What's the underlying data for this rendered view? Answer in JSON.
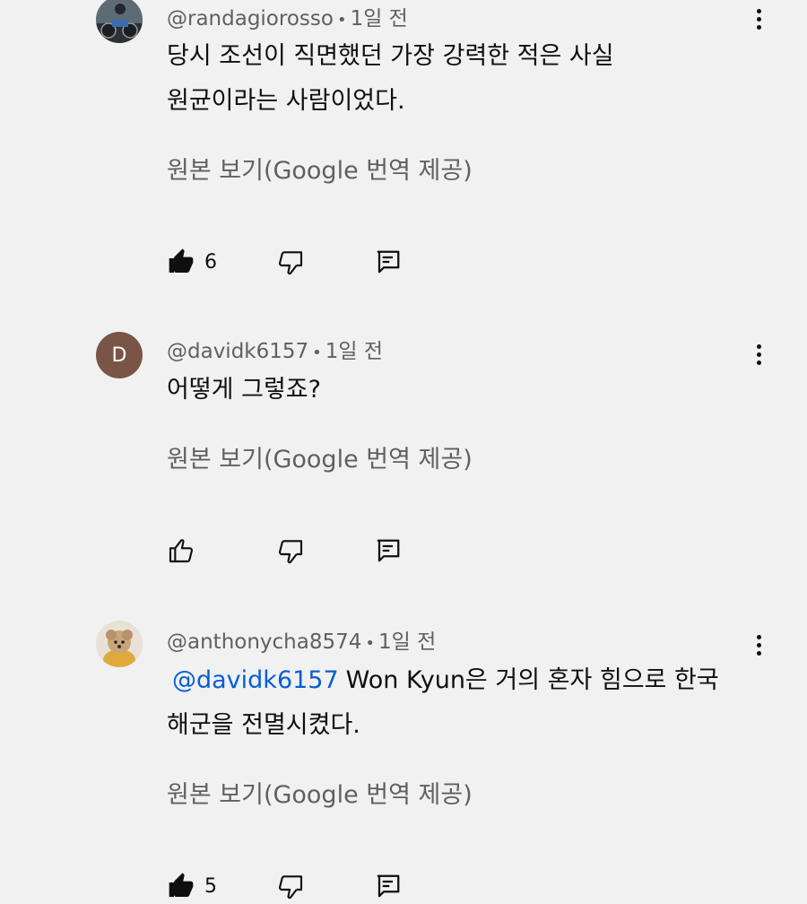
{
  "comments": [
    {
      "handle": "@randagiorosso",
      "time": "1일 전",
      "lines": [
        "당시 조선이 직면했던 가장 강력한 적은 사실",
        "원균이라는 사람이었다."
      ],
      "translate": "원본 보기(Google 번역 제공)",
      "likes": "6",
      "liked": true
    },
    {
      "handle": "@davidk6157",
      "avatar_letter": "D",
      "time": "1일 전",
      "lines": [
        "어떻게 그렇죠?"
      ],
      "translate": "원본 보기(Google 번역 제공)",
      "likes": "",
      "liked": false
    },
    {
      "handle": "@anthonycha8574",
      "time": "1일 전",
      "mention": "@davidk6157",
      "lines": [
        "Won Kyun은 거의 혼자 힘으로 한국",
        "해군을 전멸시켰다."
      ],
      "translate": "원본 보기(Google 번역 제공)",
      "likes": "5",
      "liked": true
    }
  ],
  "separator": "•",
  "colors": {
    "mention": "#065fd4",
    "meta": "#606060",
    "avatar_d": "#795548"
  },
  "icons": [
    "thumb-up-icon",
    "thumb-down-icon",
    "reply-icon",
    "more-vert-icon"
  ]
}
